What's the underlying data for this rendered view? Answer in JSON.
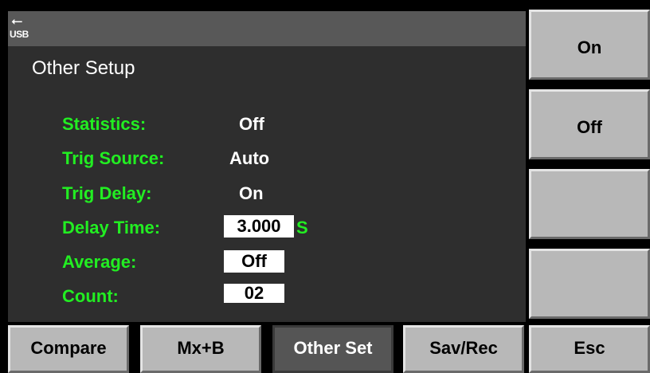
{
  "status": {
    "usb_icon": "usb-icon",
    "usb_label": "USB"
  },
  "page": {
    "title": "Other Setup"
  },
  "settings": {
    "statistics": {
      "label": "Statistics:",
      "value": "Off"
    },
    "trig_source": {
      "label": "Trig Source:",
      "value": "Auto"
    },
    "trig_delay": {
      "label": "Trig Delay:",
      "value": "On"
    },
    "delay_time": {
      "label": "Delay Time:",
      "value": "3.000",
      "unit": "S"
    },
    "average": {
      "label": "Average:",
      "value": "Off"
    },
    "count": {
      "label": "Count:",
      "value": "02"
    }
  },
  "softkeys": [
    "On",
    "Off",
    "",
    ""
  ],
  "bottom_menu": {
    "compare": "Compare",
    "mxb": "Mx+B",
    "other_set": "Other Set",
    "sav_rec": "Sav/Rec",
    "esc": "Esc"
  },
  "colors": {
    "label_green": "#22ee22",
    "panel": "#2e2e2e",
    "bar": "#585858",
    "key": "#b8b8b8",
    "active_key": "#555555"
  }
}
